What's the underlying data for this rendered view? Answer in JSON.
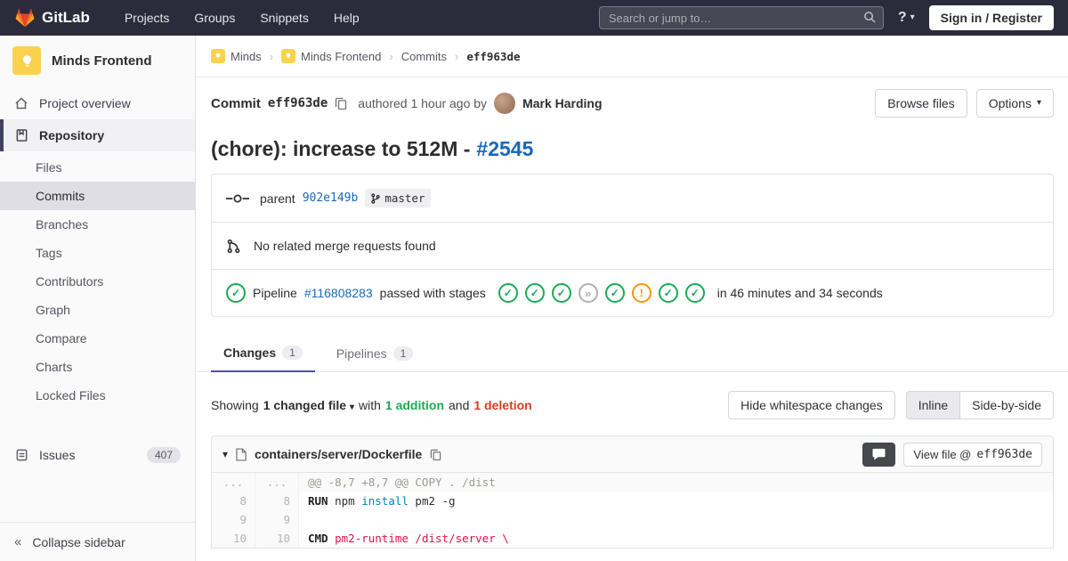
{
  "navbar": {
    "brand": "GitLab",
    "menu": [
      "Projects",
      "Groups",
      "Snippets",
      "Help"
    ],
    "search_placeholder": "Search or jump to…",
    "sign_in_label": "Sign in / Register"
  },
  "icons": {
    "caret_down": "▾",
    "chevron_double_left": "«",
    "breadcrumb_separator": "›",
    "help": "?",
    "success_check": "✓",
    "skipped": "»",
    "warning": "!"
  },
  "sidebar": {
    "project_name": "Minds Frontend",
    "overview_label": "Project overview",
    "repository_label": "Repository",
    "repo_items": [
      "Files",
      "Commits",
      "Branches",
      "Tags",
      "Contributors",
      "Graph",
      "Compare",
      "Charts",
      "Locked Files"
    ],
    "active_repo_item": "Commits",
    "issues_label": "Issues",
    "issues_count": "407",
    "collapse_label": "Collapse sidebar"
  },
  "breadcrumb": {
    "group": "Minds",
    "project": "Minds Frontend",
    "section": "Commits",
    "sha": "eff963de"
  },
  "commit": {
    "label": "Commit",
    "sha": "eff963de",
    "authored": "authored 1 hour ago by",
    "author": "Mark Harding",
    "browse_files_label": "Browse files",
    "options_label": "Options",
    "title": "(chore): increase to 512M -",
    "title_link": "#2545"
  },
  "meta": {
    "parent_label": "parent",
    "parent_sha": "902e149b",
    "branch": "master",
    "no_mr_text": "No related merge requests found",
    "pipeline_label": "Pipeline",
    "pipeline_id": "#116808283",
    "pipeline_status": "passed with stages",
    "pipeline_duration": "in 46 minutes and 34 seconds",
    "stages": [
      "success",
      "success",
      "success",
      "skipped",
      "success",
      "warning",
      "success",
      "success"
    ]
  },
  "tabs": {
    "changes_label": "Changes",
    "changes_count": "1",
    "pipelines_label": "Pipelines",
    "pipelines_count": "1"
  },
  "changes_bar": {
    "showing": "Showing",
    "changed_files": "1 changed file",
    "with_text": "with",
    "additions": "1 addition",
    "and_text": "and",
    "deletions": "1 deletion",
    "hide_whitespace_label": "Hide whitespace changes",
    "inline_label": "Inline",
    "side_by_side_label": "Side-by-side"
  },
  "diff": {
    "file_path": "containers/server/Dockerfile",
    "view_file_label": "View file @",
    "view_file_sha": "eff963de",
    "rows": [
      {
        "type": "hunk",
        "old": "...",
        "new": "...",
        "segments": [
          {
            "t": "@@ -8,7 +8,7 @@ COPY . /dist"
          }
        ]
      },
      {
        "type": "code",
        "old": "8",
        "new": "8",
        "segments": [
          {
            "t": "RUN",
            "c": "k"
          },
          {
            "t": " npm "
          },
          {
            "t": "install",
            "c": "nb"
          },
          {
            "t": " pm2 -g"
          }
        ]
      },
      {
        "type": "code",
        "old": "9",
        "new": "9",
        "segments": []
      },
      {
        "type": "code",
        "old": "10",
        "new": "10",
        "segments": [
          {
            "t": "CMD",
            "c": "k"
          },
          {
            "t": " "
          },
          {
            "t": "pm2-runtime /dist/server \\",
            "c": "s"
          }
        ]
      }
    ]
  },
  "colors": {
    "navbar_bg": "#2b2b3b",
    "link_blue": "#1b69b6",
    "success_green": "#1aaa55",
    "warning_orange": "#fc9403",
    "danger_red": "#db3b21",
    "brand_orange": "#fc6d26"
  }
}
